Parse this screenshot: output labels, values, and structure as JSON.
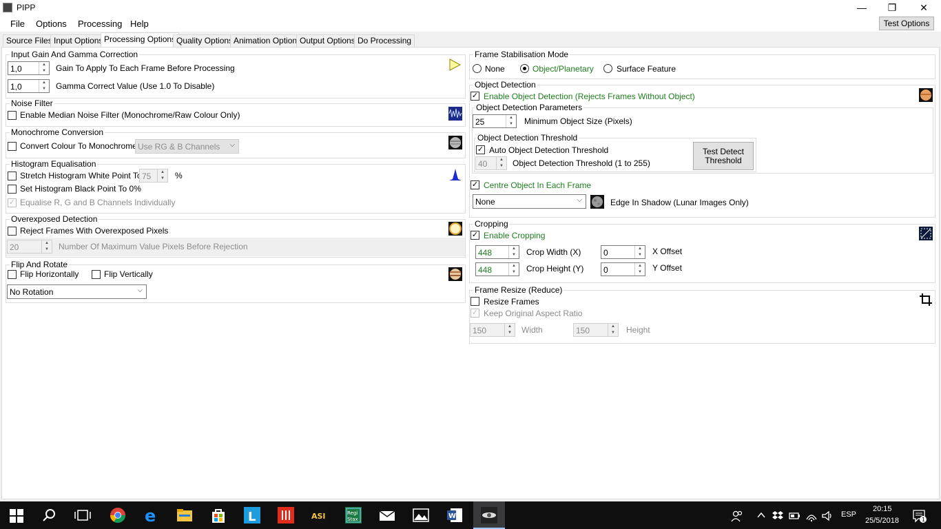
{
  "window": {
    "title": "PIPP",
    "minimize": "—",
    "restore": "❐",
    "close": "✕"
  },
  "menu": {
    "file": "File",
    "options": "Options",
    "processing": "Processing",
    "help": "Help",
    "test_options": "Test Options"
  },
  "tabs": [
    "Source Files",
    "Input Options",
    "Processing Options",
    "Quality Options",
    "Animation Options",
    "Output Options",
    "Do Processing"
  ],
  "gain": {
    "title": "Input Gain And Gamma Correction",
    "gain_value": "1,0",
    "gain_label": "Gain To Apply To Each Frame Before Processing",
    "gamma_value": "1,0",
    "gamma_label": "Gamma Correct Value (Use 1.0 To Disable)"
  },
  "noise": {
    "title": "Noise Filter",
    "median_label": "Enable Median Noise Filter (Monochrome/Raw Colour Only)"
  },
  "mono": {
    "title": "Monochrome Conversion",
    "convert_label": "Convert Colour To Monochrome",
    "channels_value": "Use RG & B Channels"
  },
  "histogram": {
    "title": "Histogram Equalisation",
    "stretch_label": "Stretch Histogram White Point To:",
    "stretch_value": "75",
    "percent": "%",
    "black_label": "Set Histogram Black Point To 0%",
    "equalise_label": "Equalise R, G and B Channels Individually"
  },
  "overexposed": {
    "title": "Overexposed Detection",
    "reject_label": "Reject Frames With Overexposed Pixels",
    "max_value": "20",
    "max_label": "Number Of Maximum Value Pixels Before Rejection"
  },
  "flip": {
    "title": "Flip And Rotate",
    "horizontal_label": "Flip Horizontally",
    "vertical_label": "Flip Vertically",
    "rotation_value": "No Rotation"
  },
  "stab": {
    "title": "Frame Stabilisation Mode",
    "none": "None",
    "object": "Object/Planetary",
    "surface": "Surface Feature"
  },
  "detection": {
    "title": "Object Detection",
    "enable_label": "Enable Object Detection (Rejects Frames Without Object)",
    "params_title": "Object Detection Parameters",
    "min_size_value": "25",
    "min_size_label": "Minimum Object Size (Pixels)",
    "threshold_title": "Object Detection Threshold",
    "auto_label": "Auto Object Detection Threshold",
    "threshold_value": "40",
    "threshold_label": "Object Detection Threshold (1 to 255)",
    "test_btn_line1": "Test Detect",
    "test_btn_line2": "Threshold",
    "centre_label": "Centre Object In Each Frame",
    "edge_value": "None",
    "edge_label": "Edge In Shadow (Lunar Images Only)"
  },
  "cropping": {
    "title": "Cropping",
    "enable_label": "Enable Cropping",
    "width_value": "448",
    "width_label": "Crop Width (X)",
    "height_value": "448",
    "height_label": "Crop Height (Y)",
    "xoff_value": "0",
    "xoff_label": "X Offset",
    "yoff_value": "0",
    "yoff_label": "Y Offset"
  },
  "resize": {
    "title": "Frame Resize (Reduce)",
    "resize_label": "Resize Frames",
    "aspect_label": "Keep Original Aspect Ratio",
    "width_value": "150",
    "width_label": "Width",
    "height_value": "150",
    "height_label": "Height"
  },
  "taskbar": {
    "lang": "ESP",
    "time": "20:15",
    "date": "25/5/2018",
    "notif_count": "1"
  },
  "colors": {
    "accent_green": "#1e7d1e",
    "taskbar": "#0f0f10"
  }
}
